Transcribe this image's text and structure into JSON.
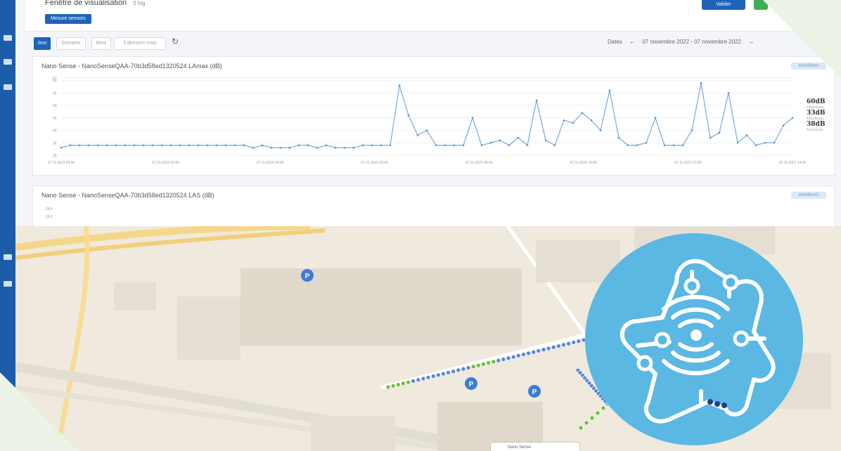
{
  "header": {
    "title": "Fenêtre de visualisation",
    "subtitle": "0 log",
    "sensor_button": "Mesure sensors",
    "primary_button": "Valider"
  },
  "toolbar": {
    "segments": [
      "Jour",
      "Semaine",
      "Mois",
      "3 derniers mois"
    ],
    "active_segment": "Jour",
    "dates_label": "Dates",
    "date_range": "07 novembre 2022 - 07 novembre 2022"
  },
  "chart1": {
    "title": "Nano Sense - NanoSenseQAA-70b3d58ed1320524 LAmax (dB)",
    "badge": "Identifiants",
    "legend": [
      {
        "value": "60dB",
        "label": "Maximum"
      },
      {
        "value": "33dB",
        "label": "Minimum"
      },
      {
        "value": "38dB",
        "label": "Moyenne"
      }
    ]
  },
  "chart2": {
    "title": "Nano Sense - NanoSenseQAA-70b3d58ed1320524 LAS (dB)",
    "badge": "Identifiants",
    "y_ticks": [
      "28.0",
      "28.4"
    ]
  },
  "map": {
    "popup_text": "Nano Sense",
    "parking_label": "P"
  },
  "colors": {
    "brand": "#1f63b8",
    "line": "#7fb0e0",
    "logo": "#5ab8e3",
    "green_dots": "#6bbf3a",
    "blue_dots": "#5a86d6"
  },
  "chart_data": {
    "type": "line",
    "title": "Nano Sense - NanoSenseQAA-70b3d58ed1320524 LAmax (dB)",
    "x": [
      "07.11.2022 00:00",
      "07.11.2022 02:00",
      "07.11.2022 04:00",
      "07.11.2022 06:00",
      "07.11.2022 08:00",
      "07.11.2022 10:00",
      "07.11.2022 12:00",
      "07.11.2022 14:00"
    ],
    "y_ticks": [
      "30",
      "35",
      "40",
      "45",
      "50",
      "55",
      "60",
      "61"
    ],
    "ylim": [
      30,
      61
    ],
    "series": [
      {
        "values": [
          33,
          34,
          34,
          34,
          34,
          34,
          34,
          34,
          34,
          34,
          34,
          34,
          34,
          34,
          34,
          34,
          34,
          34,
          34,
          34,
          34,
          33,
          34,
          33,
          33,
          33,
          34,
          34,
          33,
          34,
          33,
          33,
          33,
          34,
          34,
          34,
          34,
          58,
          46,
          38,
          40,
          34,
          34,
          34,
          34,
          45,
          34,
          35,
          36,
          34,
          37,
          34,
          52,
          36,
          34,
          44,
          43,
          47,
          44,
          40,
          56,
          37,
          34,
          34,
          35,
          45,
          34,
          34,
          34,
          40,
          59,
          37,
          39,
          55,
          35,
          38,
          34,
          35,
          35,
          42,
          45
        ]
      }
    ]
  }
}
